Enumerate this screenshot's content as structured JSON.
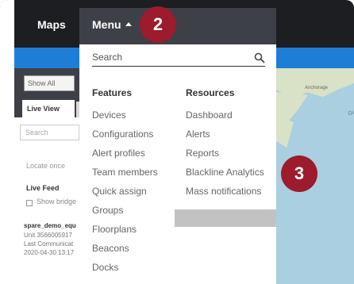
{
  "nav": {
    "maps_label": "Maps",
    "menu_label": "Menu"
  },
  "left_panel": {
    "filter_value": "Show All",
    "tab_live_view": "Live View",
    "search_placeholder": "Search",
    "locate_once": "Locate once",
    "live_feed_heading": "Live Feed",
    "show_bridge_label": "Show bridge",
    "device_name": "spare_demo_equ",
    "device_unit": "Unit 3566005917",
    "last_comm_label": "Last Communicat",
    "last_comm_date": "2020-04-30 13:17"
  },
  "map": {
    "label_anchorage": "Anchorage",
    "label_gulf": "Gulf of A"
  },
  "dropdown": {
    "search_placeholder": "Search",
    "features_heading": "Features",
    "resources_heading": "Resources",
    "features": [
      "Devices",
      "Configurations",
      "Alert profiles",
      "Team members",
      "Quick assign",
      "Groups",
      "Floorplans",
      "Beacons",
      "Docks"
    ],
    "resources": [
      "Dashboard",
      "Alerts",
      "Reports",
      "Blackline Analytics",
      "Mass notifications"
    ]
  },
  "badges": {
    "step_2": "2",
    "step_3": "3"
  },
  "colors": {
    "topbar": "#1c1e22",
    "menu_active": "#3d4047",
    "blue_bar": "#1e7ed6",
    "badge": "#9c1b2c",
    "highlight": "#c2c2c2"
  }
}
